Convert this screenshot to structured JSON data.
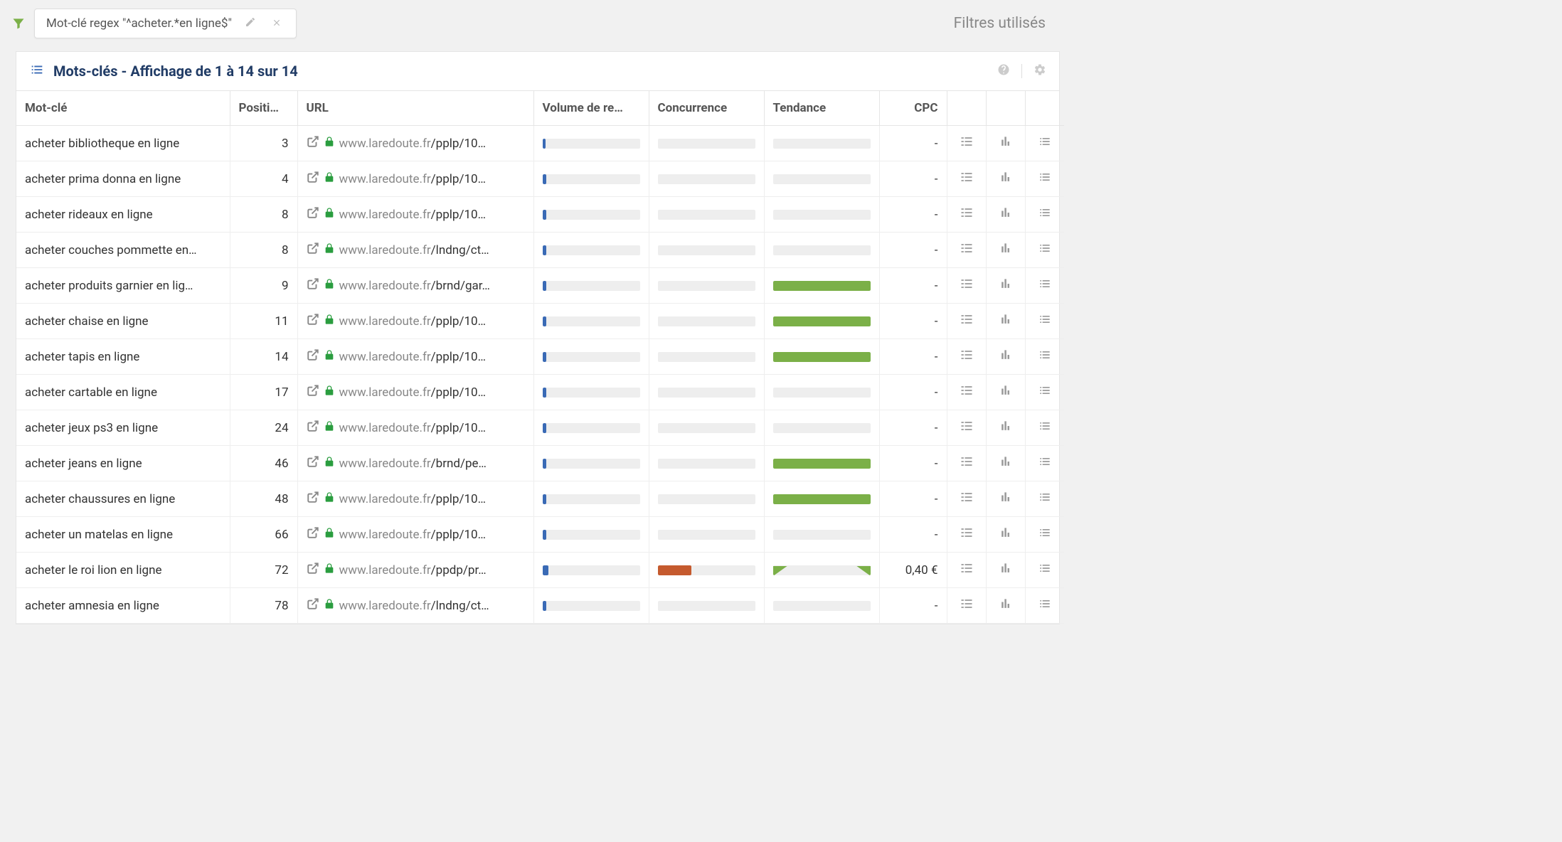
{
  "filter": {
    "chip_text": "Mot-clé regex \"^acheter.*en ligne$\""
  },
  "filters_used_label": "Filtres utilisés",
  "panel": {
    "title": "Mots-clés - Affichage de 1 à 14 sur 14"
  },
  "columns": {
    "keyword": "Mot-clé",
    "position": "Positi…",
    "url": "URL",
    "volume": "Volume de re…",
    "concurrence": "Concurrence",
    "tendance": "Tendance",
    "cpc": "CPC"
  },
  "url_parts": {
    "domain": "www.laredoute.fr",
    "path_pplp": "/pplp/10…",
    "path_lndng": "/lndng/ct…",
    "path_brnd_gar": "/brnd/gar…",
    "path_brnd_pe": "/brnd/pe…",
    "path_ppdp": "/ppdp/pr…"
  },
  "rows": [
    {
      "keyword": "acheter bibliotheque en ligne",
      "position": "3",
      "path": "path_pplp",
      "vol": 3,
      "conc": 0,
      "trend": "none",
      "cpc": "-"
    },
    {
      "keyword": "acheter prima donna en ligne",
      "position": "4",
      "path": "path_pplp",
      "vol": 4,
      "conc": 0,
      "trend": "none",
      "cpc": "-"
    },
    {
      "keyword": "acheter rideaux en ligne",
      "position": "8",
      "path": "path_pplp",
      "vol": 4,
      "conc": 0,
      "trend": "none",
      "cpc": "-"
    },
    {
      "keyword": "acheter couches pommette en…",
      "position": "8",
      "path": "path_lndng",
      "vol": 4,
      "conc": 0,
      "trend": "none",
      "cpc": "-"
    },
    {
      "keyword": "acheter produits garnier en lig…",
      "position": "9",
      "path": "path_brnd_gar",
      "vol": 4,
      "conc": 0,
      "trend": "full",
      "cpc": "-"
    },
    {
      "keyword": "acheter chaise en ligne",
      "position": "11",
      "path": "path_pplp",
      "vol": 4,
      "conc": 0,
      "trend": "full",
      "cpc": "-"
    },
    {
      "keyword": "acheter tapis en ligne",
      "position": "14",
      "path": "path_pplp",
      "vol": 4,
      "conc": 0,
      "trend": "full",
      "cpc": "-"
    },
    {
      "keyword": "acheter cartable en ligne",
      "position": "17",
      "path": "path_pplp",
      "vol": 4,
      "conc": 0,
      "trend": "none",
      "cpc": "-"
    },
    {
      "keyword": "acheter jeux ps3 en ligne",
      "position": "24",
      "path": "path_pplp",
      "vol": 4,
      "conc": 0,
      "trend": "none",
      "cpc": "-"
    },
    {
      "keyword": "acheter jeans en ligne",
      "position": "46",
      "path": "path_brnd_pe",
      "vol": 4,
      "conc": 0,
      "trend": "full",
      "cpc": "-"
    },
    {
      "keyword": "acheter chaussures en ligne",
      "position": "48",
      "path": "path_pplp",
      "vol": 4,
      "conc": 0,
      "trend": "full",
      "cpc": "-"
    },
    {
      "keyword": "acheter un matelas en ligne",
      "position": "66",
      "path": "path_pplp",
      "vol": 4,
      "conc": 0,
      "trend": "none",
      "cpc": "-"
    },
    {
      "keyword": "acheter le roi lion en ligne",
      "position": "72",
      "path": "path_ppdp",
      "vol": 6,
      "conc": 35,
      "trend": "split",
      "cpc": "0,40 €"
    },
    {
      "keyword": "acheter amnesia en ligne",
      "position": "78",
      "path": "path_lndng",
      "vol": 4,
      "conc": 0,
      "trend": "none",
      "cpc": "-"
    }
  ]
}
